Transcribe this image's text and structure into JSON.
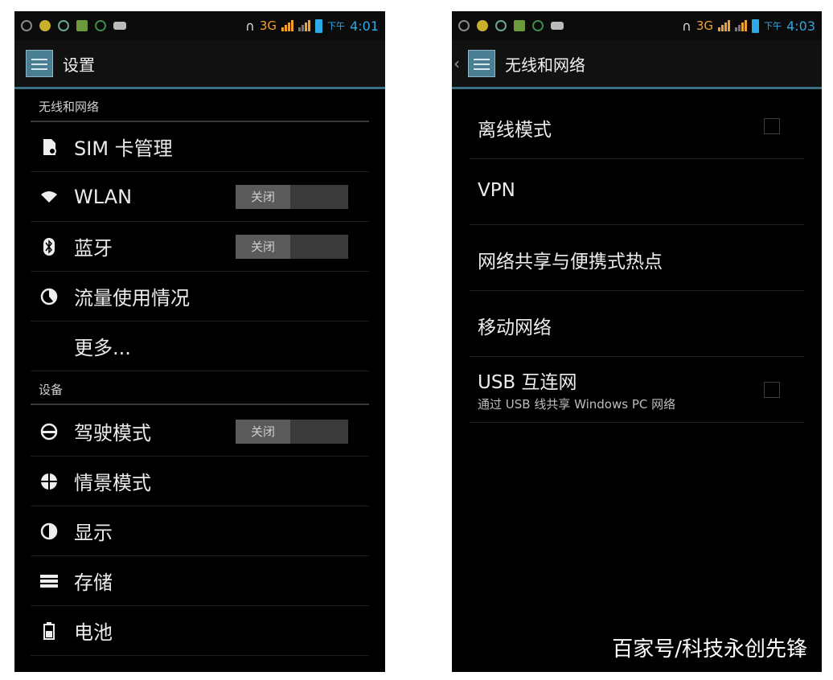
{
  "left": {
    "status_time": "4:01",
    "status_ampm": "下午",
    "status_network": "3G",
    "title": "设置",
    "sections": [
      {
        "header": "无线和网络",
        "items": [
          {
            "label": "SIM 卡管理",
            "icon": "sim-card-icon"
          },
          {
            "label": "WLAN",
            "icon": "wifi-icon",
            "toggle": "关闭"
          },
          {
            "label": "蓝牙",
            "icon": "bluetooth-icon",
            "toggle": "关闭"
          },
          {
            "label": "流量使用情况",
            "icon": "data-usage-icon"
          },
          {
            "label": "更多...",
            "icon": ""
          }
        ]
      },
      {
        "header": "设备",
        "items": [
          {
            "label": "驾驶模式",
            "icon": "driving-mode-icon",
            "toggle": "关闭"
          },
          {
            "label": "情景模式",
            "icon": "audio-profile-icon"
          },
          {
            "label": "显示",
            "icon": "display-icon"
          },
          {
            "label": "存储",
            "icon": "storage-icon"
          },
          {
            "label": "电池",
            "icon": "battery-icon"
          }
        ]
      }
    ]
  },
  "right": {
    "status_time": "4:03",
    "status_ampm": "下午",
    "status_network": "3G",
    "title": "无线和网络",
    "items": [
      {
        "label": "离线模式",
        "checkbox": true
      },
      {
        "label": "VPN"
      },
      {
        "label": "网络共享与便携式热点"
      },
      {
        "label": "移动网络"
      },
      {
        "label": "USB 互连网",
        "sub": "通过 USB 线共享 Windows PC 网络",
        "checkbox": true
      }
    ]
  },
  "watermark": "百家号/科技永创先锋",
  "colors": {
    "accent": "#2fa8e8",
    "divider": "#3a6f86",
    "network": "#f0a030"
  }
}
